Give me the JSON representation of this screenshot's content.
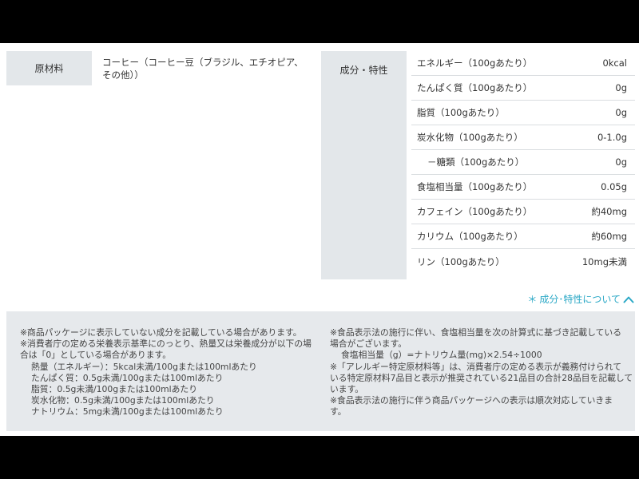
{
  "ingredients": {
    "label": "原材料",
    "lines": [
      "コーヒー（コーヒー豆（ブラジル、エチオピア、",
      "その他））"
    ]
  },
  "components": {
    "label": "成分・特性",
    "rows": [
      {
        "label": "エネルギー（100gあたり）",
        "value": "0kcal"
      },
      {
        "label": "たんぱく質（100gあたり）",
        "value": "0g"
      },
      {
        "label": "脂質（100gあたり）",
        "value": "0g"
      },
      {
        "label": "炭水化物（100gあたり）",
        "value": "0-1.0g"
      },
      {
        "label": "－糖類（100gあたり）",
        "value": "0g"
      },
      {
        "label": "食塩相当量（100gあたり）",
        "value": "0.05g"
      },
      {
        "label": "カフェイン（100gあたり）",
        "value": "約40mg"
      },
      {
        "label": "カリウム（100gあたり）",
        "value": "約60mg"
      },
      {
        "label": "リン（100gあたり）",
        "value": "10mg未満"
      }
    ]
  },
  "link": {
    "prefix": "＊",
    "label": "成分･特性について",
    "icon": "chevron-up-icon",
    "color": "#2aa8c6"
  },
  "notes": {
    "left": [
      "※商品パッケージに表示していない成分を記載している場合があります。",
      "※消費者庁の定める栄養表示基準にのっとり、熱量又は栄養成分が以下の場",
      "合は「0」としている場合があります。",
      "熱量（エネルギー）：5kcal未満/100gまたは100mlあたり",
      "たんぱく質：0.5g未満/100gまたは100mlあたり",
      "脂質：0.5g未満/100gまたは100mlあたり",
      "炭水化物：0.5g未満/100gまたは100mlあたり",
      "ナトリウム：5mg未満/100gまたは100mlあたり"
    ],
    "right": [
      "※食品表示法の施行に伴い、食塩相当量を次の計算式に基づき記載している",
      "場合がございます。",
      "食塩相当量（g）=ナトリウム量(mg)×2.54÷1000",
      "※「アレルギー特定原材料等」は、消費者庁の定める表示が義務付けられて",
      "いる特定原材料7品目と表示が推奨されている21品目の合計28品目を記載して",
      "います。",
      "※食品表示法の施行に伴う商品パッケージへの表示は順次対応していきま",
      "す。"
    ]
  }
}
